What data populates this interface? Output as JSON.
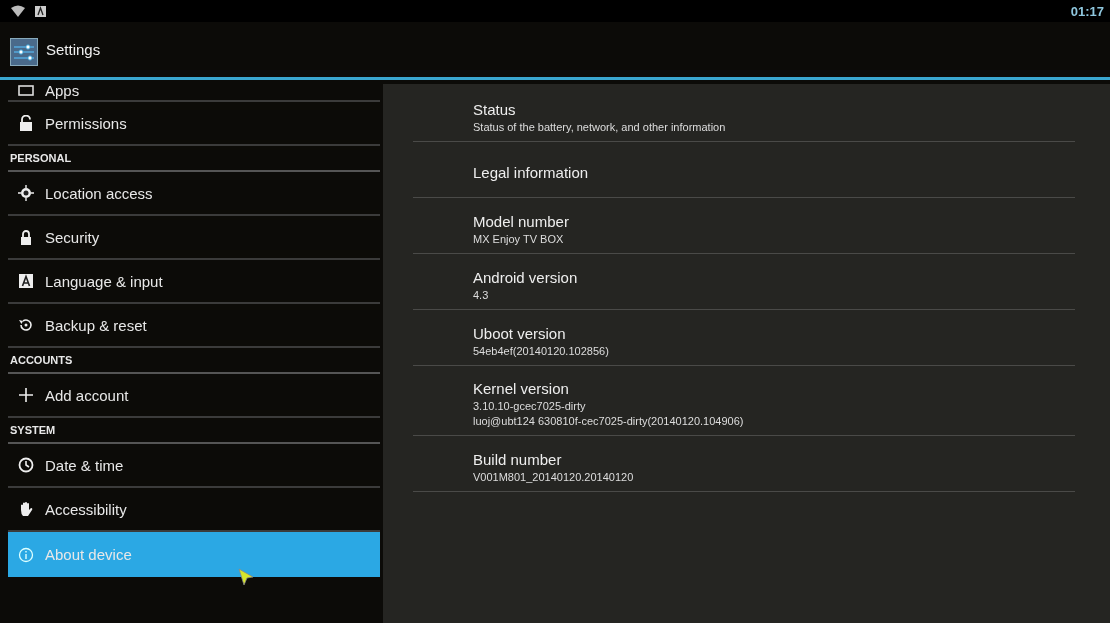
{
  "status_bar": {
    "time": "01:17"
  },
  "action_bar": {
    "title": "Settings"
  },
  "sidebar": {
    "items": [
      {
        "kind": "item",
        "label": "Apps",
        "selected": false
      },
      {
        "kind": "item",
        "label": "Permissions",
        "selected": false
      },
      {
        "kind": "header",
        "label": "PERSONAL"
      },
      {
        "kind": "item",
        "label": "Location access",
        "selected": false
      },
      {
        "kind": "item",
        "label": "Security",
        "selected": false
      },
      {
        "kind": "item",
        "label": "Language & input",
        "selected": false
      },
      {
        "kind": "item",
        "label": "Backup & reset",
        "selected": false
      },
      {
        "kind": "header",
        "label": "ACCOUNTS"
      },
      {
        "kind": "item",
        "label": "Add account",
        "selected": false
      },
      {
        "kind": "header",
        "label": "SYSTEM"
      },
      {
        "kind": "item",
        "label": "Date & time",
        "selected": false
      },
      {
        "kind": "item",
        "label": "Accessibility",
        "selected": false
      },
      {
        "kind": "item",
        "label": "About device",
        "selected": true
      }
    ]
  },
  "details": [
    {
      "title": "Status",
      "summary": [
        "Status of the battery, network, and other information"
      ]
    },
    {
      "title": "Legal information"
    },
    {
      "title": "Model number",
      "summary": [
        "MX Enjoy TV BOX"
      ]
    },
    {
      "title": "Android version",
      "summary": [
        "4.3"
      ]
    },
    {
      "title": "Uboot version",
      "summary": [
        "54eb4ef(20140120.102856)"
      ]
    },
    {
      "title": "Kernel version",
      "summary": [
        "3.10.10-gcec7025-dirty",
        "luoj@ubt124 630810f-cec7025-dirty(20140120.104906)"
      ]
    },
    {
      "title": "Build number",
      "summary": [
        "V001M801_20140120.20140120"
      ]
    }
  ]
}
